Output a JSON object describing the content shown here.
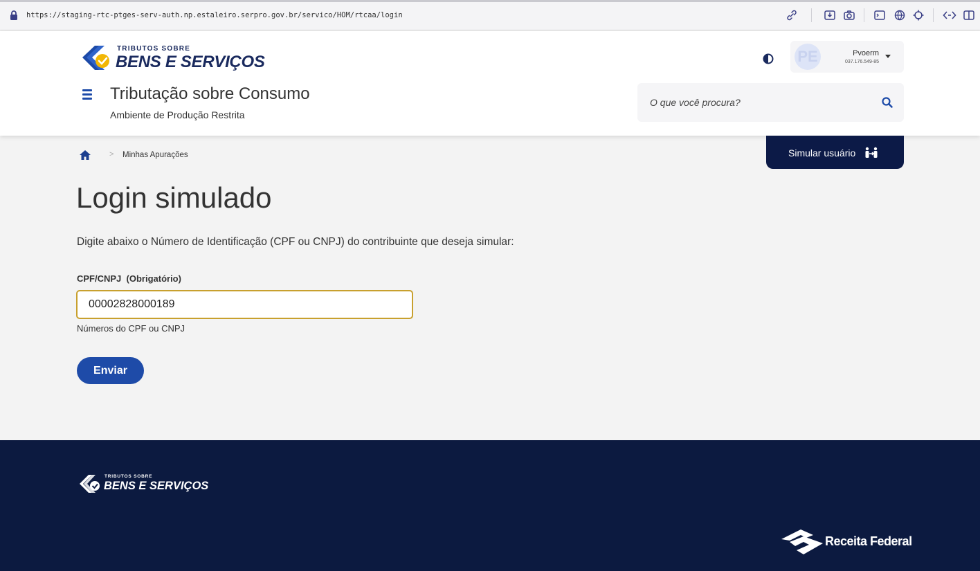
{
  "browser": {
    "url": "https://staging-rtc-ptges-serv-auth.np.estaleiro.serpro.gov.br/servico/HOM/rtcaa/login",
    "toolbar_icons": [
      "link-icon",
      "download-icon",
      "camera-icon",
      "terminal-icon",
      "globe-icon",
      "crosshair-icon",
      "code-icon",
      "sidebar-icon"
    ]
  },
  "header": {
    "logo": {
      "line1": "TRIBUTOS SOBRE",
      "line2": "BENS E SERVIÇOS"
    },
    "title": "Tributação sobre Consumo",
    "subtitle": "Ambiente de Produção Restrita",
    "user": {
      "initials": "PE",
      "name": "Pvoerm",
      "id": "037.176.549-85"
    },
    "search": {
      "placeholder": "O que você procura?"
    }
  },
  "simulate_button": {
    "label": "Simular usuário"
  },
  "breadcrumb": {
    "items": [
      "Minhas Apurações"
    ]
  },
  "main": {
    "title": "Login simulado",
    "instructions": "Digite abaixo o Número de Identificação (CPF ou CNPJ) do contribuinte que deseja simular:",
    "field": {
      "label": "CPF/CNPJ  (Obrigatório)",
      "value": "00002828000189",
      "hint": "Números do CPF ou CNPJ"
    },
    "submit_label": "Enviar"
  },
  "footer": {
    "logo": {
      "line1": "TRIBUTOS SOBRE",
      "line2": "BENS E SERVIÇOS"
    },
    "partner": "Receita Federal"
  },
  "colors": {
    "primary": "#1e4ba8",
    "navy": "#0c1a47",
    "footer": "#0c1a40",
    "input_focus": "#c8a02e",
    "logo_yellow": "#f2b705"
  }
}
